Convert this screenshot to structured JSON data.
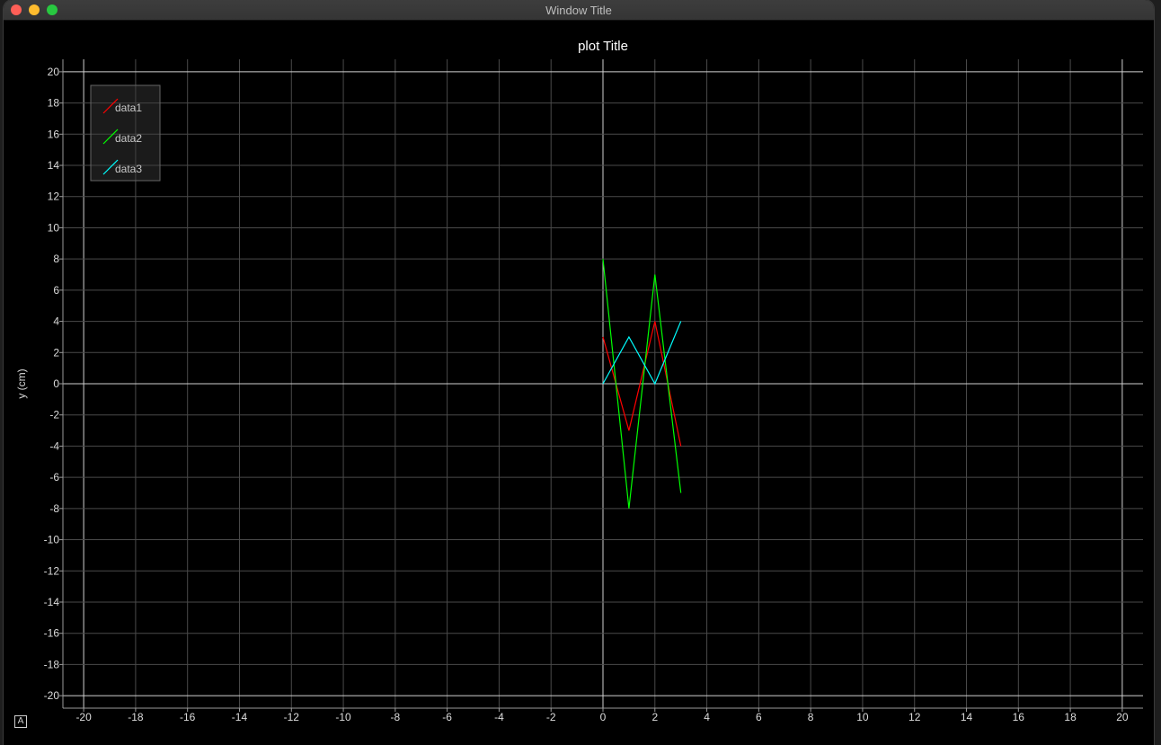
{
  "window": {
    "title": "Window Title"
  },
  "autoscale_button": {
    "label": "A"
  },
  "chart_data": {
    "type": "line",
    "title": "plot Title",
    "xlabel": "",
    "ylabel": "y (cm)",
    "xlim": [
      -20.8,
      20.8
    ],
    "ylim": [
      -20.8,
      20.8
    ],
    "x_ticks": [
      -20,
      -18,
      -16,
      -14,
      -12,
      -10,
      -8,
      -6,
      -4,
      -2,
      0,
      2,
      4,
      6,
      8,
      10,
      12,
      14,
      16,
      18,
      20
    ],
    "y_ticks": [
      20,
      18,
      16,
      14,
      12,
      10,
      8,
      6,
      4,
      2,
      0,
      -2,
      -4,
      -6,
      -8,
      -10,
      -12,
      -14,
      -16,
      -18,
      -20
    ],
    "grid": true,
    "legend_position": "top-left",
    "background": "#000000",
    "series": [
      {
        "name": "data1",
        "color": "#ff0000",
        "x": [
          0,
          1,
          2,
          3
        ],
        "y": [
          3,
          -3,
          4,
          -4
        ]
      },
      {
        "name": "data2",
        "color": "#00ff00",
        "x": [
          0,
          1,
          2,
          3
        ],
        "y": [
          8,
          -8,
          7,
          -7
        ]
      },
      {
        "name": "data3",
        "color": "#00ffff",
        "x": [
          0,
          1,
          2,
          3
        ],
        "y": [
          0,
          3,
          0,
          4
        ]
      }
    ]
  }
}
